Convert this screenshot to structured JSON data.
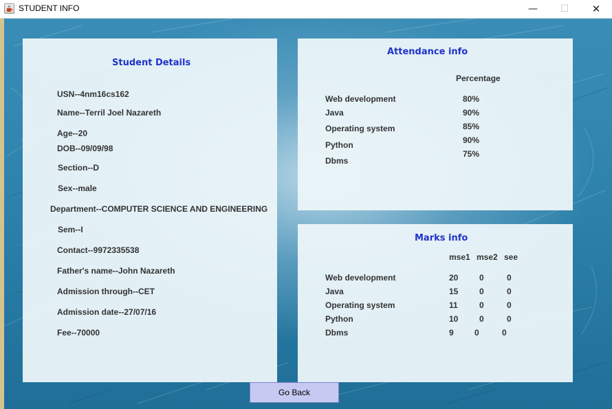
{
  "window": {
    "title": "STUDENT INFO",
    "minimize": "—",
    "maximize": "☐",
    "close": "✕"
  },
  "student": {
    "title": "Student Details",
    "usn": "USN--4nm16cs162",
    "name": "Name--Terril Joel Nazareth",
    "age": "Age--20",
    "dob": "DOB--09/09/98",
    "section": "Section--D",
    "sex": "Sex--male",
    "department": "Department--COMPUTER SCIENCE AND ENGINEERING",
    "sem": "Sem--I",
    "contact": "Contact--9972335538",
    "father": "Father's name--John Nazareth",
    "admission_through": "Admission through--CET",
    "admission_date": "Admission date--27/07/16",
    "fee": "Fee--70000"
  },
  "attendance": {
    "title": "Attendance info",
    "header": "Percentage",
    "subjects": [
      "Web development",
      "Java",
      "Operating system",
      "Python",
      "Dbms"
    ],
    "percentages": [
      "80%",
      "90%",
      "85%",
      "90%",
      "75%"
    ]
  },
  "marks": {
    "title": "Marks info",
    "headers": [
      "mse1",
      "mse2",
      "see"
    ],
    "subjects": [
      "Web development",
      "Java",
      "Operating system",
      "Python",
      "Dbms"
    ],
    "rows": [
      [
        "20",
        "0",
        "0"
      ],
      [
        "15",
        "0",
        "0"
      ],
      [
        "11",
        "0",
        "0"
      ],
      [
        "10",
        "0",
        "0"
      ],
      [
        "9",
        "0",
        "0"
      ]
    ]
  },
  "go_back_label": "Go Back"
}
